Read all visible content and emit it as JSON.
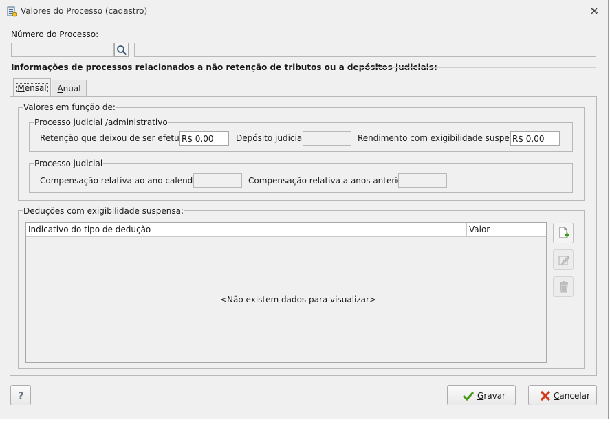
{
  "window": {
    "title": "Valores do Processo (cadastro)"
  },
  "header": {
    "numero_label": "Número do Processo:",
    "numero_value": "",
    "descricao_value": "",
    "section_title": "Informações de processos relacionados a não retenção de tributos ou a depósitos judiciais:"
  },
  "tabs": [
    {
      "prefix": "",
      "hotkey": "M",
      "rest": "ensal",
      "active": true
    },
    {
      "prefix": "",
      "hotkey": "A",
      "rest": "nual",
      "active": false
    }
  ],
  "valores": {
    "legend": "Valores em função de:",
    "judicial_admin": {
      "legend": "Processo judicial /administrativo",
      "retencao_label": "Retenção que deixou de ser efetuada",
      "retencao_value": "R$ 0,00",
      "deposito_label": "Depósito judicial",
      "deposito_value": "",
      "rendimento_label": "Rendimento com exigibilidade suspensa",
      "rendimento_value": "R$ 0,00"
    },
    "judicial": {
      "legend": "Processo judicial",
      "comp_ano_label": "Compensação relativa ao ano calendário",
      "comp_ano_value": "",
      "comp_anteriores_label": "Compensação relativa a anos anteriores",
      "comp_anteriores_value": ""
    }
  },
  "deducoes": {
    "legend": "Deduções com exigibilidade suspensa:",
    "columns": [
      "Indicativo do tipo de dedução",
      "Valor"
    ],
    "rows": [],
    "empty_message": "<Não existem dados para visualizar>"
  },
  "footer": {
    "help_label": "?",
    "gravar": {
      "hotkey": "G",
      "rest": "ravar"
    },
    "cancelar": {
      "hotkey": "C",
      "rest": "ancelar"
    }
  },
  "colors": {
    "save_check": "#4a9a1a",
    "cancel_x": "#d23a1a",
    "help_text": "#6a7a8a"
  }
}
